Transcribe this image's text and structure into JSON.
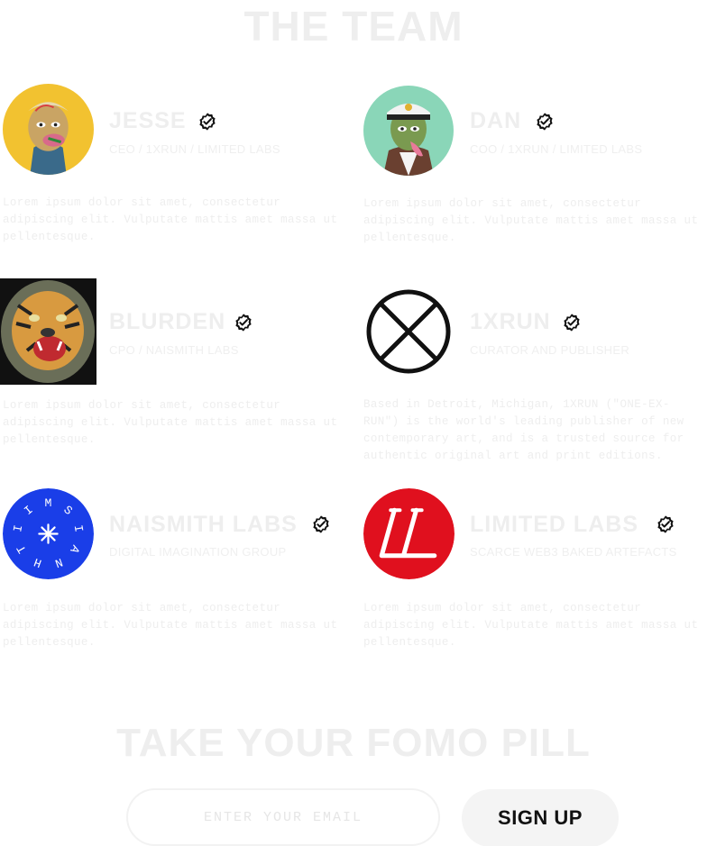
{
  "team_section": {
    "title": "THE TEAM",
    "members": [
      {
        "name": "JESSE",
        "role": "CEO  /  1XRUN  /  LIMITED LABS",
        "bio": "Lorem ipsum dolor sit amet, consectetur adipiscing elit. Vulputate mattis amet massa ut pellentesque.",
        "avatar_icon": "ape-avatar-icon"
      },
      {
        "name": "DAN",
        "role": "COO  /  1XRUN  /  LIMITED LABS",
        "bio": "Lorem ipsum dolor sit amet, consectetur adipiscing elit. Vulputate mattis amet massa ut pellentesque.",
        "avatar_icon": "captain-ape-avatar-icon"
      },
      {
        "name": "BLURDEN",
        "role": "CPO  /  NAISMITH LABS",
        "bio": "Lorem ipsum dolor sit amet, consectetur adipiscing elit. Vulputate mattis amet massa ut pellentesque.",
        "avatar_icon": "tiger-avatar-icon"
      },
      {
        "name": "1XRUN",
        "role": "CURATOR AND PUBLISHER",
        "bio": "Based in Detroit, Michigan, 1XRUN (\"ONE-EX-RUN\") is the world's leading publisher of new contemporary art, and is a trusted source for authentic original art and print editions.",
        "avatar_icon": "1xrun-logo-icon"
      },
      {
        "name": "NAISMITH LABS",
        "role": "DIGITAL IMAGINATION GROUP",
        "bio": "Lorem ipsum dolor sit amet, consectetur adipiscing elit. Vulputate mattis amet massa ut pellentesque.",
        "avatar_icon": "naismith-logo-icon",
        "logo_text": "NAISMITH"
      },
      {
        "name": "LIMITED LABS",
        "role": "SCARCE WEB3 BAKED ARTEFACTS",
        "bio": "Lorem ipsum dolor sit amet, consectetur adipiscing elit. Vulputate mattis amet massa ut pellentesque.",
        "avatar_icon": "limited-labs-logo-icon",
        "logo_text": "LL"
      }
    ],
    "verified_icon": "verified-check-icon"
  },
  "signup_section": {
    "title": "TAKE YOUR FOMO PILL",
    "email_placeholder": "ENTER YOUR EMAIL",
    "email_value": "",
    "signup_label": "SIGN UP"
  },
  "colors": {
    "background": "#ffffff",
    "faded_text": "#eeeeee",
    "naismith_blue": "#1a3ee8",
    "limited_red": "#e0101e",
    "button_bg": "#f4f4f4"
  }
}
